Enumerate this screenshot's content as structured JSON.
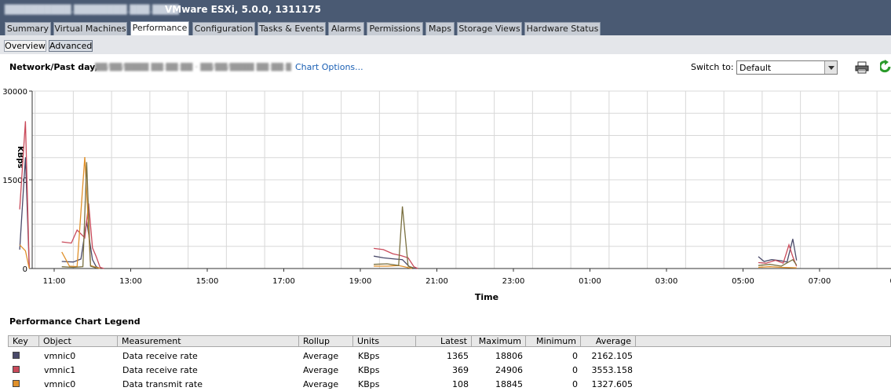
{
  "header": {
    "host": "██████████.████████.███.████",
    "title": "VMware ESXi, 5.0.0, 1311175"
  },
  "tabs": [
    {
      "label": "Summary"
    },
    {
      "label": "Virtual Machines"
    },
    {
      "label": "Performance"
    },
    {
      "label": "Configuration"
    },
    {
      "label": "Tasks & Events"
    },
    {
      "label": "Alarms"
    },
    {
      "label": "Permissions"
    },
    {
      "label": "Maps"
    },
    {
      "label": "Storage Views"
    },
    {
      "label": "Hardware Status"
    }
  ],
  "subtabs": [
    {
      "label": "Overview"
    },
    {
      "label": "Advanced"
    }
  ],
  "toolbar": {
    "chart_title": "Network/Past day,",
    "date_range": "██/██/████ ██:██:██ - ██/██/████ ██:██:██",
    "chart_options": "Chart Options...",
    "switch_to_label": "Switch to:",
    "switch_to_value": "Default"
  },
  "colors": {
    "vmnic0_receive": "#4a4a6a",
    "vmnic1_receive": "#c94a5a",
    "vmnic0_transmit": "#e0902a",
    "series4": "#7a7040"
  },
  "chart_data": {
    "type": "line",
    "ylabel": "KBps",
    "xlabel": "Time",
    "ylim": [
      0,
      30000
    ],
    "yticks": [
      "30000",
      "15000",
      "0"
    ],
    "xticks": [
      "11:00",
      "13:00",
      "15:00",
      "17:00",
      "19:00",
      "21:00",
      "23:00",
      "01:00",
      "03:00",
      "05:00",
      "07:00",
      "09:"
    ],
    "grid": true,
    "series": [
      {
        "name": "vmnic0 Data receive rate",
        "color": "#4a4a6a",
        "segments": [
          [
            [
              10.1,
              3200
            ],
            [
              10.25,
              18806
            ],
            [
              10.35,
              0
            ]
          ],
          [
            [
              11.2,
              1200
            ],
            [
              11.5,
              1100
            ],
            [
              11.7,
              1600
            ],
            [
              11.85,
              8000
            ],
            [
              12.0,
              1500
            ],
            [
              12.1,
              300
            ],
            [
              12.2,
              0
            ]
          ],
          [
            [
              19.35,
              2100
            ],
            [
              19.6,
              1800
            ],
            [
              19.9,
              1600
            ],
            [
              20.1,
              1500
            ],
            [
              20.3,
              200
            ],
            [
              20.45,
              0
            ]
          ],
          [
            [
              29.4,
              2000
            ],
            [
              29.55,
              1200
            ],
            [
              29.75,
              1500
            ],
            [
              30.0,
              1300
            ],
            [
              30.15,
              1100
            ],
            [
              30.3,
              5000
            ],
            [
              30.4,
              1365
            ]
          ]
        ]
      },
      {
        "name": "vmnic1 Data receive rate",
        "color": "#c94a5a",
        "segments": [
          [
            [
              10.1,
              10000
            ],
            [
              10.25,
              24906
            ],
            [
              10.35,
              0
            ]
          ],
          [
            [
              11.2,
              4500
            ],
            [
              11.45,
              4300
            ],
            [
              11.6,
              6500
            ],
            [
              11.8,
              5200
            ],
            [
              11.9,
              11000
            ],
            [
              12.0,
              3500
            ],
            [
              12.1,
              2000
            ],
            [
              12.2,
              200
            ],
            [
              12.3,
              0
            ]
          ],
          [
            [
              19.35,
              3400
            ],
            [
              19.6,
              3200
            ],
            [
              19.85,
              2500
            ],
            [
              20.05,
              2200
            ],
            [
              20.25,
              1800
            ],
            [
              20.4,
              300
            ],
            [
              20.5,
              0
            ]
          ],
          [
            [
              29.4,
              1000
            ],
            [
              29.6,
              900
            ],
            [
              29.85,
              1400
            ],
            [
              30.05,
              900
            ],
            [
              30.2,
              4000
            ],
            [
              30.3,
              2000
            ],
            [
              30.4,
              369
            ]
          ]
        ]
      },
      {
        "name": "vmnic0 Data transmit rate",
        "color": "#e0902a",
        "segments": [
          [
            [
              10.1,
              4000
            ],
            [
              10.25,
              3000
            ],
            [
              10.35,
              0
            ]
          ],
          [
            [
              11.2,
              2800
            ],
            [
              11.4,
              400
            ],
            [
              11.6,
              300
            ],
            [
              11.8,
              18845
            ],
            [
              11.95,
              500
            ],
            [
              12.1,
              200
            ],
            [
              12.2,
              0
            ]
          ],
          [
            [
              19.35,
              400
            ],
            [
              19.7,
              400
            ],
            [
              20.0,
              500
            ],
            [
              20.15,
              300
            ],
            [
              20.35,
              0
            ]
          ],
          [
            [
              29.4,
              200
            ],
            [
              29.7,
              300
            ],
            [
              30.0,
              200
            ],
            [
              30.4,
              108
            ]
          ]
        ]
      },
      {
        "color": "#7a7040",
        "segments": [
          [
            [
              11.2,
              300
            ],
            [
              11.5,
              200
            ],
            [
              11.75,
              300
            ],
            [
              11.85,
              18000
            ],
            [
              11.95,
              400
            ],
            [
              12.1,
              100
            ]
          ],
          [
            [
              19.35,
              700
            ],
            [
              19.7,
              800
            ],
            [
              20.0,
              500
            ],
            [
              20.1,
              10500
            ],
            [
              20.25,
              400
            ],
            [
              20.4,
              100
            ]
          ],
          [
            [
              29.4,
              500
            ],
            [
              29.7,
              700
            ],
            [
              30.0,
              400
            ],
            [
              30.3,
              1500
            ],
            [
              30.4,
              600
            ]
          ]
        ]
      }
    ]
  },
  "legend": {
    "title": "Performance Chart Legend",
    "columns": [
      "Key",
      "Object",
      "Measurement",
      "Rollup",
      "Units",
      "Latest",
      "Maximum",
      "Minimum",
      "Average"
    ],
    "rows": [
      {
        "color": "#4a4a6a",
        "object": "vmnic0",
        "measurement": "Data receive rate",
        "rollup": "Average",
        "units": "KBps",
        "latest": "1365",
        "maximum": "18806",
        "minimum": "0",
        "average": "2162.105"
      },
      {
        "color": "#c94a5a",
        "object": "vmnic1",
        "measurement": "Data receive rate",
        "rollup": "Average",
        "units": "KBps",
        "latest": "369",
        "maximum": "24906",
        "minimum": "0",
        "average": "3553.158"
      },
      {
        "color": "#e0902a",
        "object": "vmnic0",
        "measurement": "Data transmit rate",
        "rollup": "Average",
        "units": "KBps",
        "latest": "108",
        "maximum": "18845",
        "minimum": "0",
        "average": "1327.605"
      }
    ]
  }
}
